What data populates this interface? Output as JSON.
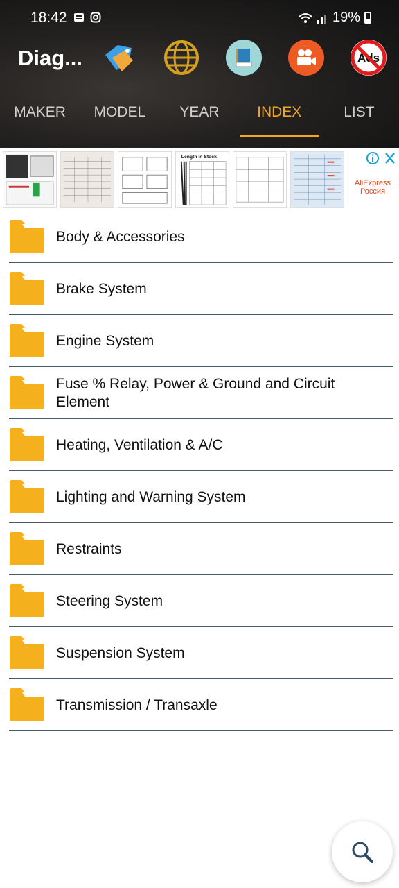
{
  "status": {
    "time": "18:42",
    "battery": "19%"
  },
  "app": {
    "title": "Diag..."
  },
  "toolbar_icons": [
    "tag-icon",
    "globe-icon",
    "book-icon",
    "video-icon",
    "no-ads-icon"
  ],
  "tabs": [
    {
      "label": "MAKER",
      "active": false
    },
    {
      "label": "MODEL",
      "active": false
    },
    {
      "label": "YEAR",
      "active": false
    },
    {
      "label": "INDEX",
      "active": true
    },
    {
      "label": "LIST",
      "active": false
    }
  ],
  "ad": {
    "brand_line1": "AliExpress",
    "brand_line2": "Россия",
    "thumb_title": "Length in Stock"
  },
  "index_items": [
    {
      "label": "Body & Accessories"
    },
    {
      "label": "Brake System"
    },
    {
      "label": "Engine System"
    },
    {
      "label": "Fuse % Relay, Power & Ground and Circuit Element"
    },
    {
      "label": "Heating, Ventilation & A/C"
    },
    {
      "label": "Lighting and Warning System"
    },
    {
      "label": "Restraints"
    },
    {
      "label": "Steering System"
    },
    {
      "label": "Suspension System"
    },
    {
      "label": "Transmission / Transaxle"
    }
  ],
  "colors": {
    "accent": "#f5a522",
    "folder": "#f5b01e",
    "separator": "#4a5a66"
  }
}
